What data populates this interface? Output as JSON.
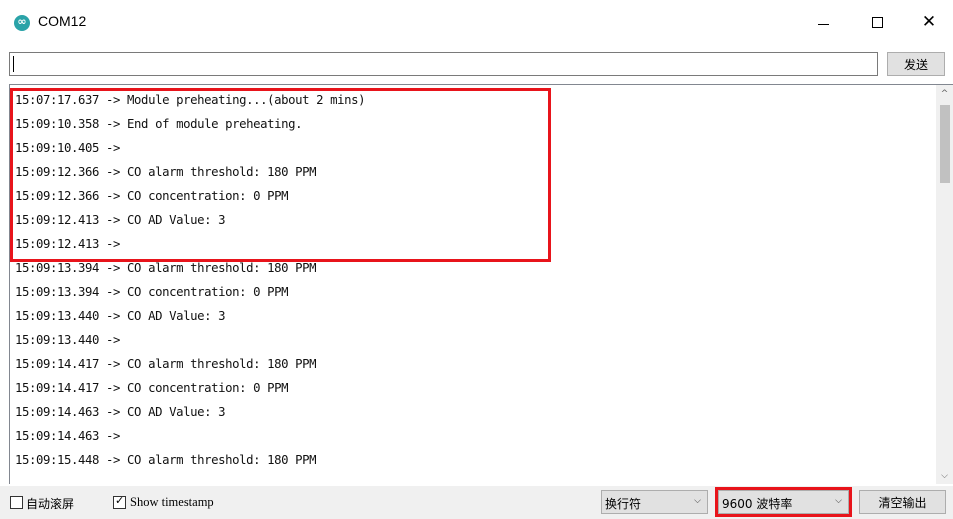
{
  "window": {
    "title": "COM12",
    "icon": "arduino-icon",
    "minimize_icon": "minimize-icon",
    "maximize_icon": "maximize-icon",
    "close_icon": "close-icon",
    "close_glyph": "✕"
  },
  "send": {
    "input_value": "",
    "button_label": "发送"
  },
  "log": [
    "15:07:17.637 -> Module preheating...(about 2 mins)",
    "15:09:10.358 -> End of module preheating.",
    "15:09:10.405 -> ",
    "15:09:12.366 -> CO alarm threshold: 180 PPM",
    "15:09:12.366 -> CO concentration: 0 PPM",
    "15:09:12.413 -> CO AD Value: 3",
    "15:09:12.413 -> ",
    "15:09:13.394 -> CO alarm threshold: 180 PPM",
    "15:09:13.394 -> CO concentration: 0 PPM",
    "15:09:13.440 -> CO AD Value: 3",
    "15:09:13.440 -> ",
    "15:09:14.417 -> CO alarm threshold: 180 PPM",
    "15:09:14.417 -> CO concentration: 0 PPM",
    "15:09:14.463 -> CO AD Value: 3",
    "15:09:14.463 -> ",
    "15:09:15.448 -> CO alarm threshold: 180 PPM"
  ],
  "bottom": {
    "autoscroll_label": "自动滚屏",
    "autoscroll_checked": false,
    "timestamp_label": "Show timestamp",
    "timestamp_checked": true,
    "checkmark": "✓",
    "line_ending": "换行符",
    "baud_rate": "9600 波特率",
    "clear_label": "清空输出",
    "dropdown_glyph": "⌵"
  },
  "colors": {
    "highlight": "#e8141b",
    "arduino": "#2aa3a8"
  }
}
